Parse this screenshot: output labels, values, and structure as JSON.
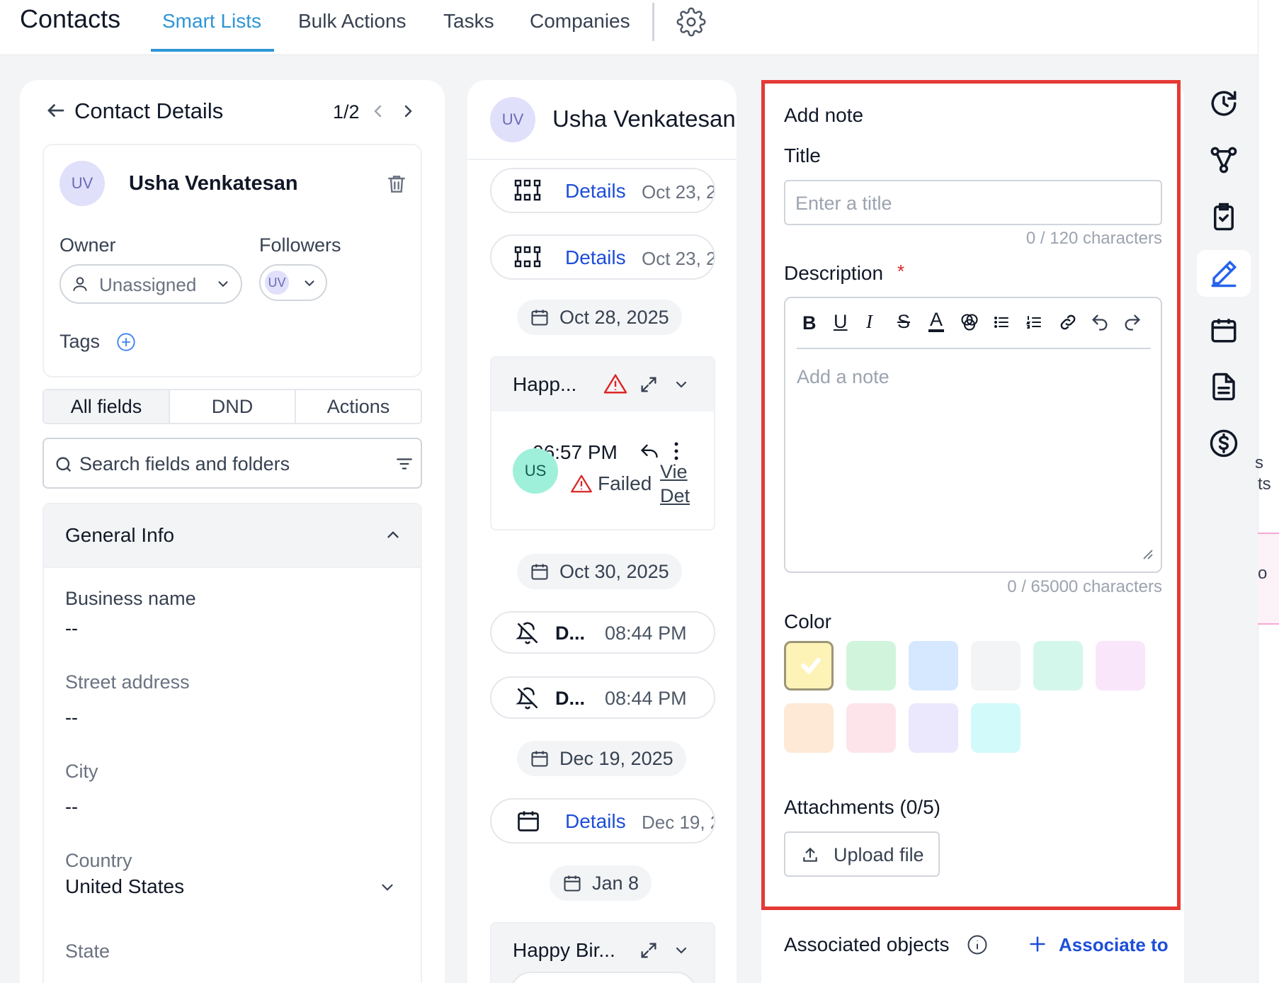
{
  "header": {
    "app_title": "Contacts",
    "tabs": [
      {
        "label": "Smart Lists",
        "active": true
      },
      {
        "label": "Bulk Actions"
      },
      {
        "label": "Tasks"
      },
      {
        "label": "Companies"
      }
    ]
  },
  "contact_details": {
    "title": "Contact Details",
    "pager": "1/2",
    "contact": {
      "initials": "UV",
      "name": "Usha Venkatesan"
    },
    "owner_label": "Owner",
    "owner_value": "Unassigned",
    "followers_label": "Followers",
    "follower_initials": "UV",
    "tags_label": "Tags",
    "segments": [
      "All fields",
      "DND",
      "Actions"
    ],
    "search_placeholder": "Search fields and folders",
    "section_title": "General Info",
    "fields": [
      {
        "label": "Business name",
        "value": "--"
      },
      {
        "label": "Street address",
        "value": "--"
      },
      {
        "label": "City",
        "value": "--"
      },
      {
        "label": "Country",
        "value": "United States"
      },
      {
        "label": "State",
        "value": ""
      }
    ]
  },
  "timeline": {
    "contact_initials": "UV",
    "contact_name": "Usha Venkatesan",
    "items": {
      "details1": {
        "link": "Details",
        "date": "Oct 23, 2"
      },
      "details2": {
        "link": "Details",
        "date": "Oct 23, 2"
      },
      "date1": "Oct 28, 2025",
      "email1": {
        "subject": "Happ...",
        "time": "06:57 PM",
        "sender_initials": "US",
        "status": "Failed",
        "view_link_1": "Vie",
        "view_link_2": "Det"
      },
      "date2": "Oct 30, 2025",
      "dnd1": {
        "label": "D...",
        "time": "08:44 PM"
      },
      "dnd2": {
        "label": "D...",
        "time": "08:44 PM"
      },
      "date3": "Dec 19, 2025",
      "details3": {
        "link": "Details",
        "date": "Dec 19, 2"
      },
      "date4": "Jan 8",
      "email2": {
        "subject": "Happy Bir..."
      }
    }
  },
  "add_note": {
    "heading": "Add note",
    "title_label": "Title",
    "title_placeholder": "Enter a title",
    "title_counter": "0 / 120 characters",
    "description_label": "Description",
    "required_mark": "*",
    "description_placeholder": "Add a note",
    "description_counter": "0 / 65000 characters",
    "color_label": "Color",
    "colors": [
      "#fdf3b7",
      "#d1f5dc",
      "#d6e8ff",
      "#f3f4f6",
      "#d4f7ec",
      "#fae6fb",
      "#fee9d6",
      "#fde4ea",
      "#ebe8fd",
      "#d3fafb"
    ],
    "selected_color": "#fdf3b7",
    "attachments_label": "Attachments (0/5)",
    "upload_label": "Upload file",
    "associated_label": "Associated objects",
    "associate_link": "Associate to",
    "highlight_color": "#e53935"
  },
  "right_rail": {
    "icons": [
      "history-icon",
      "workflow-icon",
      "clipboard-check-icon",
      "pen-icon",
      "calendar-icon",
      "document-icon",
      "dollar-icon"
    ],
    "active": "pen-icon",
    "partial_text_1": "s",
    "partial_text_2": "ts",
    "partial_text_3": "o"
  }
}
